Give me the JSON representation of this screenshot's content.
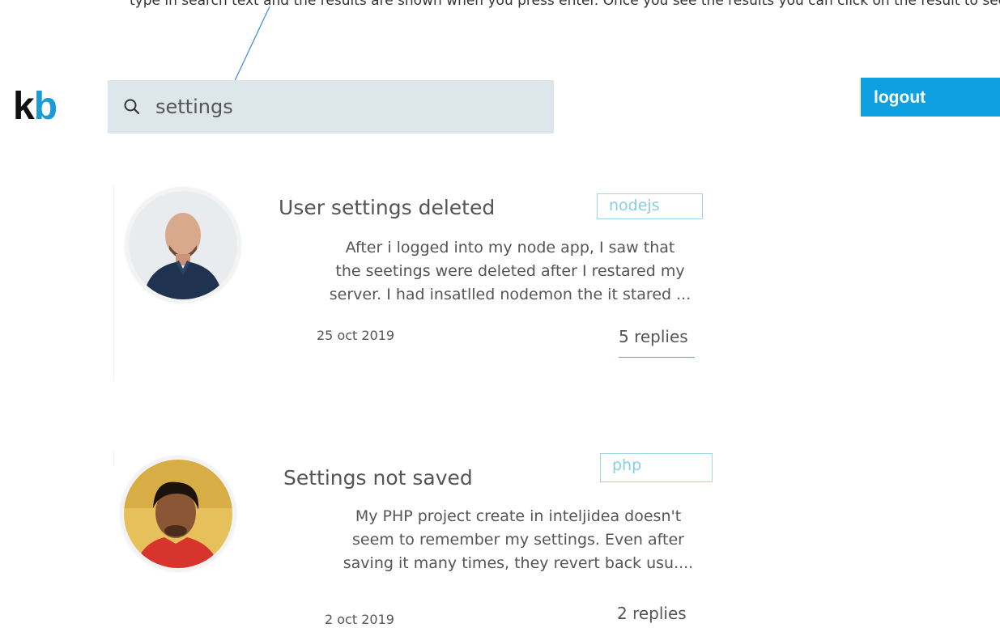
{
  "caption": "type in search text and the results are shown when you press enter. Once you see the results you can click on the result to see the thread of that type",
  "colors": {
    "brand_black": "#111111",
    "brand_blue": "#1a9bd7",
    "logout_bg": "#0ea0e0",
    "search_bg": "#dde6ea",
    "tag_border": "#9ed6ea",
    "annotation_arrow": "#4a8fd8"
  },
  "header": {
    "logo_k": "k",
    "logo_b": "b",
    "search": {
      "icon": "search-icon",
      "value": "settings",
      "placeholder": ""
    },
    "logout_label": "logout"
  },
  "posts": [
    {
      "title": "User settings deleted",
      "tag": "nodejs",
      "excerpt": "After i logged into my node app, I saw that\nthe seetings were deleted after I restared my\nserver. I had insatlled nodemon the it stared ...",
      "date": "25 oct 2019",
      "replies": "5 replies"
    },
    {
      "title": "Settings not saved",
      "tag": "php",
      "excerpt": "My PHP project create in inteljidea doesn't\nseem to remember my settings. Even after\nsaving it many times, they revert back usu....",
      "date": "2  oct 2019",
      "replies": "2 replies"
    }
  ]
}
